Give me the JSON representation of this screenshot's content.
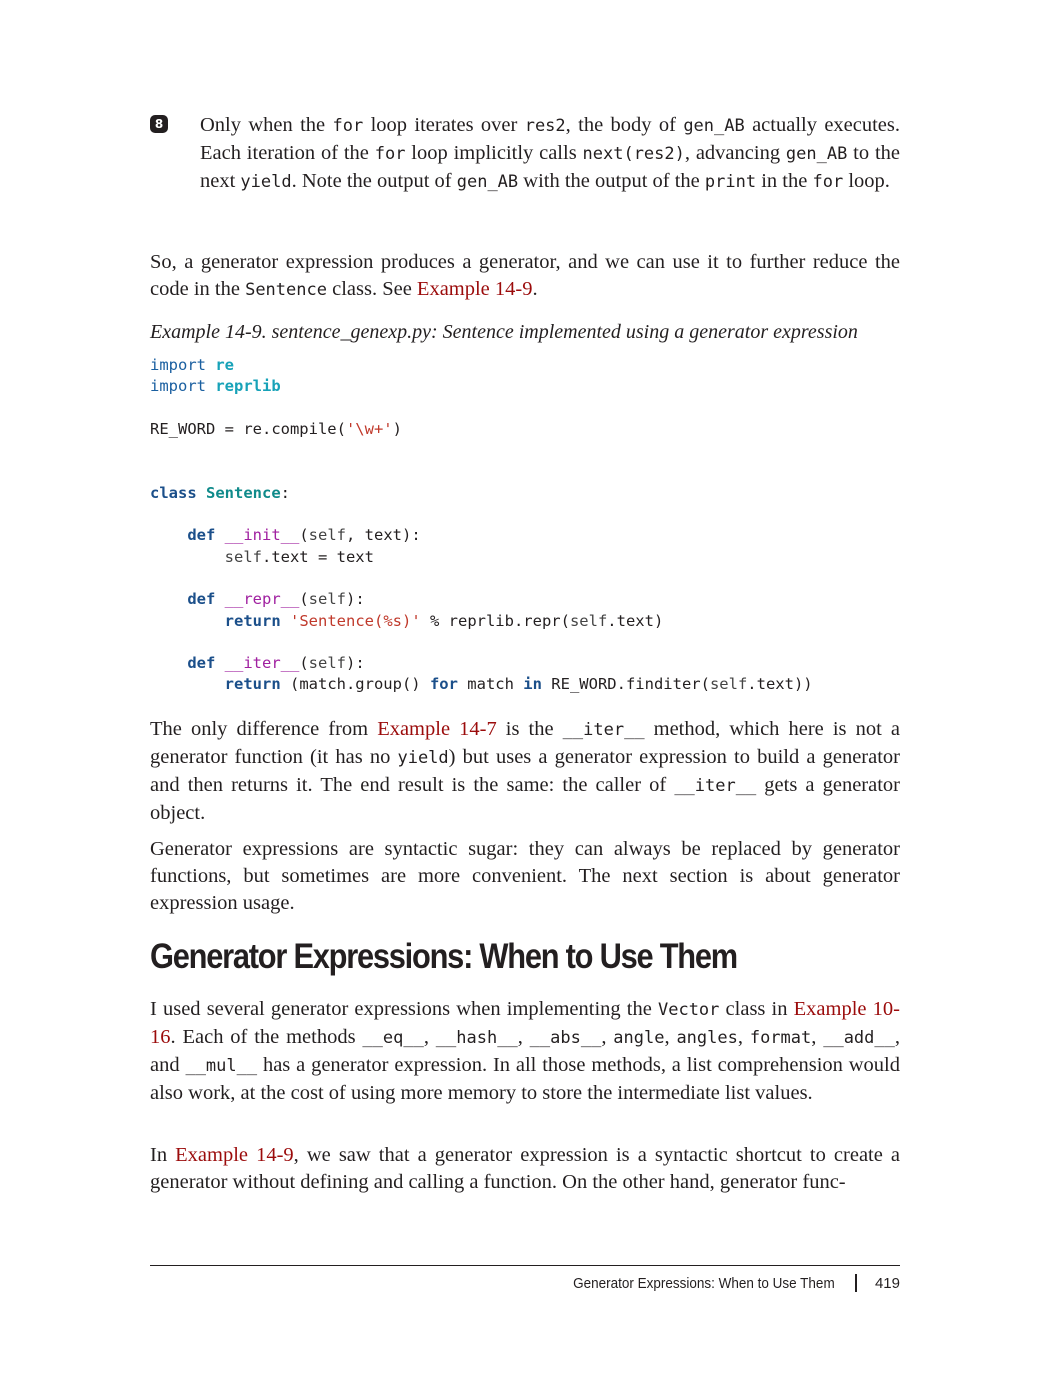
{
  "callout": {
    "marker": "8",
    "segments": [
      {
        "t": "Only when the ",
        "c": ""
      },
      {
        "t": "for",
        "c": "mono"
      },
      {
        "t": " loop iterates over ",
        "c": ""
      },
      {
        "t": "res2",
        "c": "mono"
      },
      {
        "t": ", the body of ",
        "c": ""
      },
      {
        "t": "gen_AB",
        "c": "mono"
      },
      {
        "t": " actually executes. Each iteration of the ",
        "c": ""
      },
      {
        "t": "for",
        "c": "mono"
      },
      {
        "t": " loop implicitly calls ",
        "c": ""
      },
      {
        "t": "next(res2)",
        "c": "mono"
      },
      {
        "t": ", advancing ",
        "c": ""
      },
      {
        "t": "gen_AB",
        "c": "mono"
      },
      {
        "t": " to the next ",
        "c": ""
      },
      {
        "t": "yield",
        "c": "mono"
      },
      {
        "t": ". Note the output of ",
        "c": ""
      },
      {
        "t": "gen_AB",
        "c": "mono"
      },
      {
        "t": " with the output of the ",
        "c": ""
      },
      {
        "t": "print",
        "c": "mono"
      },
      {
        "t": " in the ",
        "c": ""
      },
      {
        "t": "for",
        "c": "mono"
      },
      {
        "t": " loop.",
        "c": ""
      }
    ]
  },
  "para1": [
    {
      "t": "So, a generator expression produces a generator, and we can use it to further reduce the code in the ",
      "c": ""
    },
    {
      "t": "Sentence",
      "c": "mono"
    },
    {
      "t": " class. See ",
      "c": ""
    },
    {
      "t": "Example 14-9",
      "c": "link"
    },
    {
      "t": ".",
      "c": ""
    }
  ],
  "caption": "Example 14-9. sentence_genexp.py: Sentence implemented using a generator expression",
  "code": [
    [
      {
        "t": "import",
        "c": "kw2"
      },
      {
        "t": " ",
        "c": ""
      },
      {
        "t": "re",
        "c": "mod"
      }
    ],
    [
      {
        "t": "import",
        "c": "kw2"
      },
      {
        "t": " ",
        "c": ""
      },
      {
        "t": "reprlib",
        "c": "mod"
      }
    ],
    [],
    [
      {
        "t": "RE_WORD = re.compile(",
        "c": ""
      },
      {
        "t": "'\\w+'",
        "c": "str"
      },
      {
        "t": ")",
        "c": ""
      }
    ],
    [],
    [],
    [
      {
        "t": "class",
        "c": "kw"
      },
      {
        "t": " ",
        "c": ""
      },
      {
        "t": "Sentence",
        "c": "cls"
      },
      {
        "t": ":",
        "c": ""
      }
    ],
    [],
    [
      {
        "t": "    ",
        "c": ""
      },
      {
        "t": "def",
        "c": "kw"
      },
      {
        "t": " ",
        "c": ""
      },
      {
        "t": "__init__",
        "c": "mag"
      },
      {
        "t": "(",
        "c": ""
      },
      {
        "t": "self",
        "c": "self"
      },
      {
        "t": ", text):",
        "c": ""
      }
    ],
    [
      {
        "t": "        ",
        "c": ""
      },
      {
        "t": "self",
        "c": "self"
      },
      {
        "t": ".text = text",
        "c": ""
      }
    ],
    [],
    [
      {
        "t": "    ",
        "c": ""
      },
      {
        "t": "def",
        "c": "kw"
      },
      {
        "t": " ",
        "c": ""
      },
      {
        "t": "__repr__",
        "c": "mag"
      },
      {
        "t": "(",
        "c": ""
      },
      {
        "t": "self",
        "c": "self"
      },
      {
        "t": "):",
        "c": ""
      }
    ],
    [
      {
        "t": "        ",
        "c": ""
      },
      {
        "t": "return",
        "c": "kw"
      },
      {
        "t": " ",
        "c": ""
      },
      {
        "t": "'Sentence(%s)'",
        "c": "str"
      },
      {
        "t": " % reprlib.repr(",
        "c": ""
      },
      {
        "t": "self",
        "c": "self"
      },
      {
        "t": ".text)",
        "c": ""
      }
    ],
    [],
    [
      {
        "t": "    ",
        "c": ""
      },
      {
        "t": "def",
        "c": "kw"
      },
      {
        "t": " ",
        "c": ""
      },
      {
        "t": "__iter__",
        "c": "mag"
      },
      {
        "t": "(",
        "c": ""
      },
      {
        "t": "self",
        "c": "self"
      },
      {
        "t": "):",
        "c": ""
      }
    ],
    [
      {
        "t": "        ",
        "c": ""
      },
      {
        "t": "return",
        "c": "kw"
      },
      {
        "t": " (match.group() ",
        "c": ""
      },
      {
        "t": "for",
        "c": "kw"
      },
      {
        "t": " match ",
        "c": ""
      },
      {
        "t": "in",
        "c": "kw"
      },
      {
        "t": " RE_WORD.finditer(",
        "c": ""
      },
      {
        "t": "self",
        "c": "self"
      },
      {
        "t": ".text))",
        "c": ""
      }
    ]
  ],
  "para2": [
    {
      "t": "The only difference from ",
      "c": ""
    },
    {
      "t": "Example 14-7",
      "c": "link"
    },
    {
      "t": " is the ",
      "c": ""
    },
    {
      "t": "__iter__",
      "c": "mono"
    },
    {
      "t": " method, which here is not a generator function (it has no ",
      "c": ""
    },
    {
      "t": "yield",
      "c": "mono"
    },
    {
      "t": ") but uses a generator expression to build a generator and then returns it. The end result is the same: the caller of ",
      "c": ""
    },
    {
      "t": "__iter__",
      "c": "mono"
    },
    {
      "t": " gets a generator object.",
      "c": ""
    }
  ],
  "para3": [
    {
      "t": "Generator expressions are syntactic sugar: they can always be replaced by generator functions, but sometimes are more convenient. The next section is about generator expression usage.",
      "c": ""
    }
  ],
  "heading": "Generator Expressions: When to Use Them",
  "para4": [
    {
      "t": "I used several generator expressions when implementing the ",
      "c": ""
    },
    {
      "t": "Vector",
      "c": "mono"
    },
    {
      "t": " class in ",
      "c": ""
    },
    {
      "t": "Example 10-16",
      "c": "link"
    },
    {
      "t": ". Each of the methods ",
      "c": ""
    },
    {
      "t": "__eq__",
      "c": "mono"
    },
    {
      "t": ", ",
      "c": ""
    },
    {
      "t": "__hash__",
      "c": "mono"
    },
    {
      "t": ", ",
      "c": ""
    },
    {
      "t": "__abs__",
      "c": "mono"
    },
    {
      "t": ", ",
      "c": ""
    },
    {
      "t": "angle",
      "c": "mono"
    },
    {
      "t": ", ",
      "c": ""
    },
    {
      "t": "angles",
      "c": "mono"
    },
    {
      "t": ", ",
      "c": ""
    },
    {
      "t": "format",
      "c": "mono"
    },
    {
      "t": ", ",
      "c": ""
    },
    {
      "t": "__add__",
      "c": "mono"
    },
    {
      "t": ", and ",
      "c": ""
    },
    {
      "t": "__mul__",
      "c": "mono"
    },
    {
      "t": " has a generator expression. In all those methods, a list comprehension would also work, at the cost of using more memory to store the inter­mediate list values.",
      "c": ""
    }
  ],
  "para5": [
    {
      "t": "In ",
      "c": ""
    },
    {
      "t": "Example 14-9",
      "c": "link"
    },
    {
      "t": ", we saw that a generator expression is a syntactic shortcut to create a generator without defining and calling a function. On the other hand, generator func-",
      "c": ""
    }
  ],
  "footer": {
    "title": "Generator Expressions: When to Use Them",
    "page": "419"
  }
}
